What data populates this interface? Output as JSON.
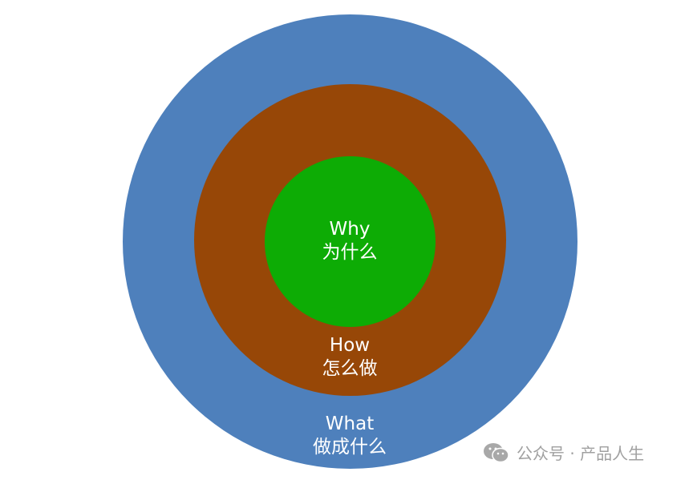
{
  "colors": {
    "what": "#4e80bc",
    "how": "#974707",
    "why": "#0dac05"
  },
  "rings": {
    "why": {
      "en": "Why",
      "zh": "为什么"
    },
    "how": {
      "en": "How",
      "zh": "怎么做"
    },
    "what": {
      "en": "What",
      "zh": "做成什么"
    }
  },
  "watermark": {
    "icon": "wechat-icon",
    "text": "公众号 · 产品人生"
  }
}
